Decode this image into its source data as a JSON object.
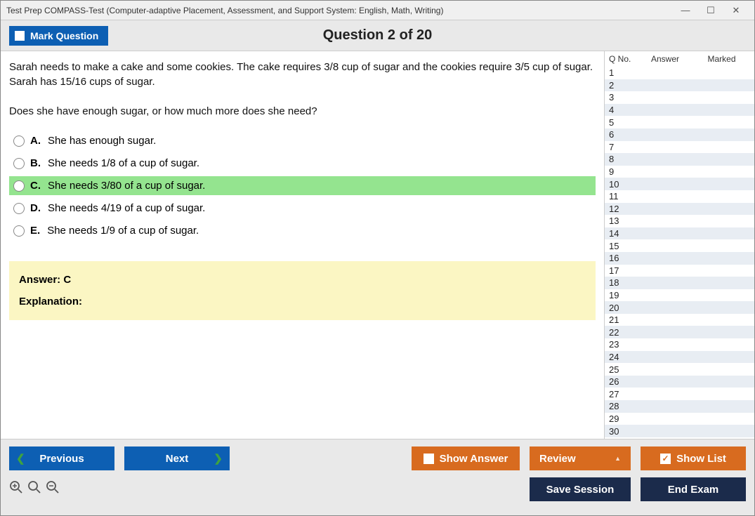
{
  "window": {
    "title": "Test Prep COMPASS-Test (Computer-adaptive Placement, Assessment, and Support System: English, Math, Writing)"
  },
  "header": {
    "mark_label": "Mark Question",
    "question_title": "Question 2 of 20"
  },
  "question": {
    "text": "Sarah needs to make a cake and some cookies. The cake requires 3/8 cup of sugar and the cookies require 3/5 cup of sugar. Sarah has 15/16 cups of sugar.\n\nDoes she have enough sugar, or how much more does she need?",
    "options": [
      {
        "letter": "A.",
        "text": "She has enough sugar.",
        "selected": false
      },
      {
        "letter": "B.",
        "text": "She needs 1/8 of a cup of sugar.",
        "selected": false
      },
      {
        "letter": "C.",
        "text": "She needs 3/80 of a cup of sugar.",
        "selected": true
      },
      {
        "letter": "D.",
        "text": "She needs 4/19 of a cup of sugar.",
        "selected": false
      },
      {
        "letter": "E.",
        "text": "She needs 1/9 of a cup of sugar.",
        "selected": false
      }
    ],
    "answer_label": "Answer: C",
    "explanation_label": "Explanation:"
  },
  "sidebar": {
    "h_qno": "Q No.",
    "h_answer": "Answer",
    "h_marked": "Marked",
    "rows": [
      1,
      2,
      3,
      4,
      5,
      6,
      7,
      8,
      9,
      10,
      11,
      12,
      13,
      14,
      15,
      16,
      17,
      18,
      19,
      20,
      21,
      22,
      23,
      24,
      25,
      26,
      27,
      28,
      29,
      30
    ]
  },
  "footer": {
    "previous": "Previous",
    "next": "Next",
    "show_answer": "Show Answer",
    "review": "Review",
    "show_list": "Show List",
    "save_session": "Save Session",
    "end_exam": "End Exam"
  }
}
